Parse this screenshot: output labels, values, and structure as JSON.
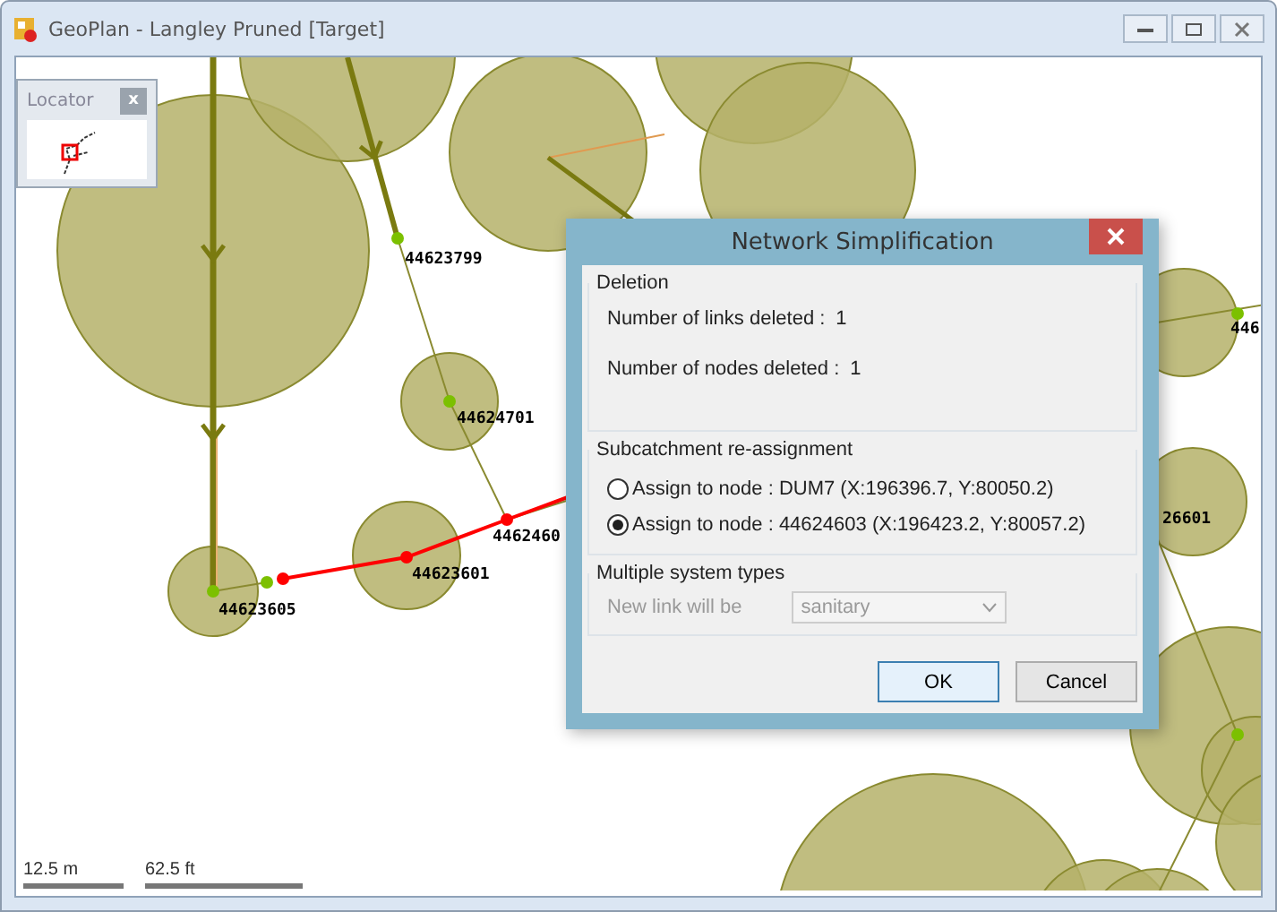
{
  "window": {
    "title": "GeoPlan - Langley Pruned [Target]"
  },
  "locator": {
    "title": "Locator",
    "close": "x"
  },
  "map": {
    "node_labels": [
      "44623799",
      "44624701",
      "4462460",
      "44623601",
      "44623605",
      "446",
      "26601"
    ],
    "scale_bars": [
      {
        "label": "12.5 m"
      },
      {
        "label": "62.5 ft"
      }
    ]
  },
  "dialog": {
    "title": "Network Simplification",
    "deletion": {
      "legend": "Deletion",
      "rows": [
        {
          "label": "Number of links deleted :",
          "value": "1"
        },
        {
          "label": "Number of nodes deleted :",
          "value": "1"
        }
      ]
    },
    "reassignment": {
      "legend": "Subcatchment re-assignment",
      "options": [
        {
          "label": "Assign to node : DUM7 (X:196396.7, Y:80050.2)",
          "selected": false
        },
        {
          "label": "Assign to node : 44624603 (X:196423.2, Y:80057.2)",
          "selected": true
        }
      ]
    },
    "system_types": {
      "legend": "Multiple system types",
      "label": "New link will be",
      "value": "sanitary",
      "disabled": true
    },
    "buttons": [
      {
        "label": "OK",
        "default": true
      },
      {
        "label": "Cancel",
        "default": false
      }
    ]
  }
}
